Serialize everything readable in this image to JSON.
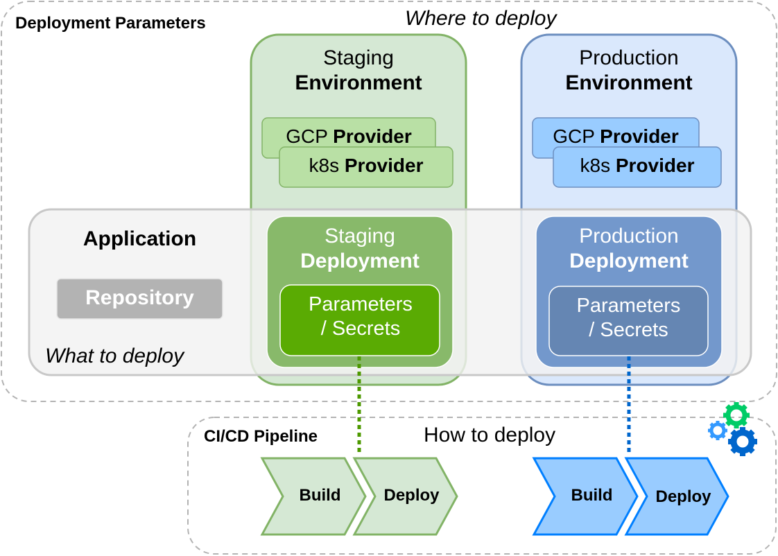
{
  "diagram": {
    "deployment_parameters": {
      "title": "Deployment Parameters",
      "caption": "Where to deploy"
    },
    "environments": [
      {
        "id": "staging",
        "title_regular": "Staging",
        "title_bold": "Environment",
        "providers": [
          {
            "regular": "GCP",
            "bold": "Provider"
          },
          {
            "regular": "k8s",
            "bold": "Provider"
          }
        ],
        "colors": {
          "fill": "#d5e8d4",
          "stroke": "#82b366",
          "provider_fill": "#b9e0a5"
        }
      },
      {
        "id": "production",
        "title_regular": "Production",
        "title_bold": "Environment",
        "providers": [
          {
            "regular": "GCP",
            "bold": "Provider"
          },
          {
            "regular": "k8s",
            "bold": "Provider"
          }
        ],
        "colors": {
          "fill": "#dae8fc",
          "stroke": "#6c8ebf",
          "provider_fill": "#99ccff"
        }
      }
    ],
    "application": {
      "title": "Application",
      "repository_label": "Repository",
      "caption": "What to deploy"
    },
    "deployments": [
      {
        "id": "staging",
        "title_regular": "Staging",
        "title_bold": "Deployment",
        "params_line1": "Parameters",
        "params_line2": "/ Secrets",
        "colors": {
          "fill": "#88b96a",
          "params_fill": "#5aab03",
          "link": "#4d9900"
        }
      },
      {
        "id": "production",
        "title_regular": "Production",
        "title_bold": "Deployment",
        "params_line1": "Parameters",
        "params_line2": "/ Secrets",
        "colors": {
          "fill": "#7398cc",
          "params_fill": "#6586b3",
          "link": "#0066cc"
        }
      }
    ],
    "pipeline": {
      "title": "CI/CD Pipeline",
      "caption": "How to deploy",
      "icon": "gears-icon",
      "stages": [
        {
          "group": "staging",
          "steps": [
            "Build",
            "Deploy"
          ],
          "fill": "#d5e8d4",
          "stroke": "#82b366"
        },
        {
          "group": "production",
          "steps": [
            "Build",
            "Deploy"
          ],
          "fill": "#99ccff",
          "stroke": "#007fff"
        }
      ]
    }
  }
}
